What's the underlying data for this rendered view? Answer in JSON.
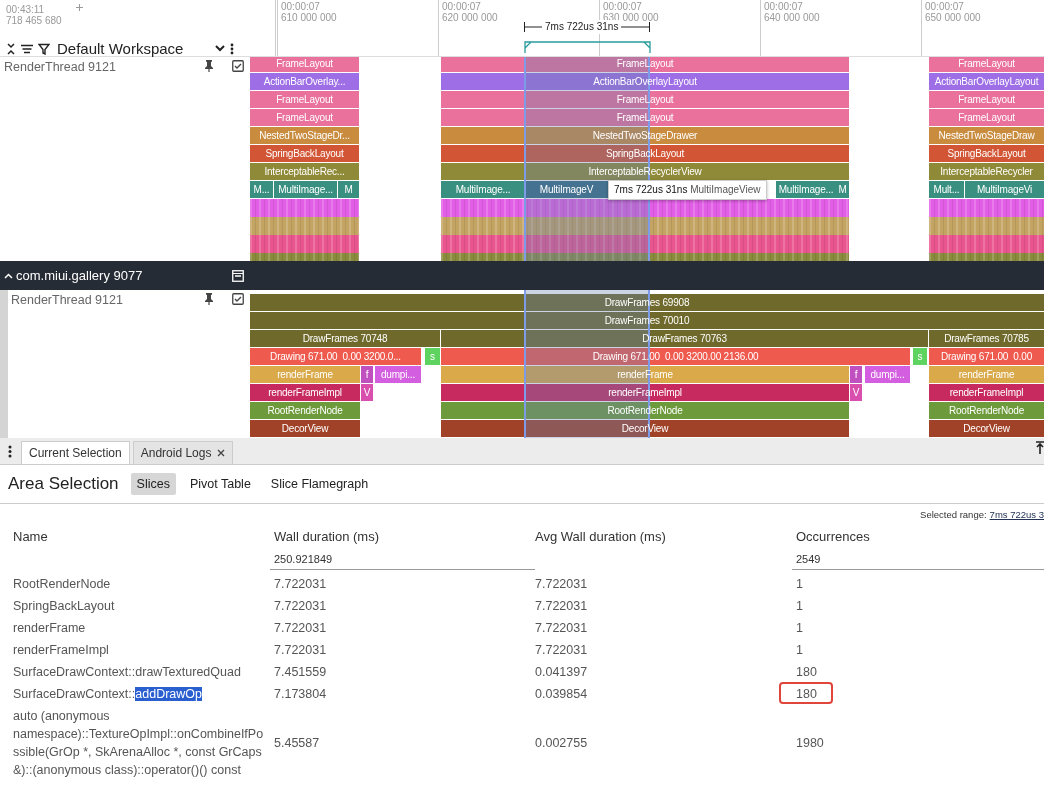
{
  "timeline": {
    "origin_time": "00:43:11",
    "origin_offset": "718 465 680",
    "workspace": "Default Workspace",
    "selection_span": "7ms 722us 31ns",
    "ticks": [
      {
        "time": "00:00:07",
        "offset": "610 000 000"
      },
      {
        "time": "00:00:07",
        "offset": "620 000 000"
      },
      {
        "time": "00:00:07",
        "offset": "630 000 000"
      },
      {
        "time": "00:00:07",
        "offset": "640 000 000"
      },
      {
        "time": "00:00:07",
        "offset": "650 000 000"
      }
    ]
  },
  "tracks": [
    {
      "name": "RenderThread 9121",
      "checked": true,
      "slice_rows": [
        [
          {
            "label": "FrameLayout",
            "color": "#e9719b"
          },
          {
            "label": "FrameLayout",
            "color": "#e9719b"
          },
          {
            "label": "FrameLayout",
            "color": "#e9719b"
          }
        ],
        [
          {
            "label": "ActionBarOverlay...",
            "color": "#9d6ee6"
          },
          {
            "label": "ActionBarOverlayLayout",
            "color": "#9d6ee6"
          },
          {
            "label": "ActionBarOverlayLayout",
            "color": "#9d6ee6"
          }
        ],
        [
          {
            "label": "FrameLayout",
            "color": "#e9719b"
          },
          {
            "label": "FrameLayout",
            "color": "#e9719b"
          },
          {
            "label": "FrameLayout",
            "color": "#e9719b"
          }
        ],
        [
          {
            "label": "FrameLayout",
            "color": "#e9719b"
          },
          {
            "label": "FrameLayout",
            "color": "#e9719b"
          },
          {
            "label": "FrameLayout",
            "color": "#e9719b"
          }
        ],
        [
          {
            "label": "NestedTwoStageDr...",
            "color": "#c98c3f"
          },
          {
            "label": "NestedTwoStageDrawer",
            "color": "#c98c3f"
          },
          {
            "label": "NestedTwoStageDraw",
            "color": "#c98c3f"
          }
        ],
        [
          {
            "label": "SpringBackLayout",
            "color": "#d25535"
          },
          {
            "label": "SpringBackLayout",
            "color": "#d25535"
          },
          {
            "label": "SpringBackLayout",
            "color": "#d25535"
          }
        ],
        [
          {
            "label": "InterceptableRec...",
            "color": "#8f8a37"
          },
          {
            "label": "InterceptableRecyclerView",
            "color": "#8f8a37"
          },
          {
            "label": "InterceptableRecycler",
            "color": "#8f8a37"
          }
        ],
        [
          {
            "label": "M...",
            "color": "#3a9080"
          },
          {
            "label": "MultiImage...",
            "color": "#3a9080"
          },
          {
            "label": "M",
            "color": "#3a9080"
          },
          {
            "label": "MultiImage...",
            "color": "#3a9080"
          },
          {
            "label": "MultiImageV",
            "color": "#2f6a80"
          },
          {
            "label": "MultiImage...",
            "color": "#3a9080"
          },
          {
            "label": "M",
            "color": "#3a9080"
          },
          {
            "label": "Mult...",
            "color": "#3a9080"
          },
          {
            "label": "MultiImageVi",
            "color": "#3a9080"
          }
        ]
      ],
      "tooltip": "**7ms 722us 31ns** MultiImageView"
    },
    {
      "name": "RenderThread 9121",
      "checked": true,
      "slice_rows": [
        [
          {
            "label": "DrawFrames 69908",
            "color": "#6f6a2c"
          }
        ],
        [
          {
            "label": "DrawFrames 70010",
            "color": "#6f6a2c"
          }
        ],
        [
          {
            "label": "DrawFrames 70748",
            "color": "#6f6a2c"
          },
          {
            "label": "DrawFrames 70763",
            "color": "#6f6a2c"
          },
          {
            "label": "DrawFrames 70785",
            "color": "#6f6a2c"
          }
        ],
        [
          {
            "label": "Drawing 671.00  0.00 3200.0...",
            "color": "#ef5a4e"
          },
          {
            "label": "s",
            "color": "#5fd35f"
          },
          {
            "label": "Drawing 671.00  0.00 3200.00 2136.00",
            "color": "#ef5a4e"
          },
          {
            "label": "s",
            "color": "#5fd35f"
          },
          {
            "label": "Drawing 671.00  0.00",
            "color": "#ef5a4e"
          }
        ],
        [
          {
            "label": "renderFrame",
            "color": "#d9a94a"
          },
          {
            "label": "f",
            "color": "#c04fc0"
          },
          {
            "label": "dumpi...",
            "color": "#d45ee0"
          },
          {
            "label": "renderFrame",
            "color": "#d9a94a"
          },
          {
            "label": "f",
            "color": "#c04fc0"
          },
          {
            "label": "dumpi...",
            "color": "#d45ee0"
          },
          {
            "label": "renderFrame",
            "color": "#d9a94a"
          }
        ],
        [
          {
            "label": "renderFrameImpl",
            "color": "#c72a5e"
          },
          {
            "label": "V",
            "color": "#d84fae"
          },
          {
            "label": "renderFrameImpl",
            "color": "#c72a5e"
          },
          {
            "label": "V",
            "color": "#d84fae"
          },
          {
            "label": "renderFrameImpl",
            "color": "#c72a5e"
          }
        ],
        [
          {
            "label": "RootRenderNode",
            "color": "#6d9a3a"
          },
          {
            "label": "RootRenderNode",
            "color": "#6d9a3a"
          },
          {
            "label": "RootRenderNode",
            "color": "#6d9a3a"
          }
        ],
        [
          {
            "label": "DecorView",
            "color": "#a04228"
          },
          {
            "label": "DecorView",
            "color": "#a04228"
          },
          {
            "label": "DecorView",
            "color": "#a04228"
          }
        ]
      ]
    }
  ],
  "group": {
    "title": "com.miui.gallery 9077",
    "expanded": true
  },
  "details": {
    "tabs": [
      {
        "label": "Current Selection",
        "selected": true,
        "closable": false
      },
      {
        "label": "Android Logs",
        "selected": false,
        "closable": true
      }
    ],
    "title": "Area Selection",
    "views": [
      {
        "label": "Slices",
        "selected": true
      },
      {
        "label": "Pivot Table",
        "selected": false
      },
      {
        "label": "Slice Flamegraph",
        "selected": false
      }
    ],
    "selected_range_label": "Selected range:",
    "selected_range_value": "7ms 722us 3",
    "columns": [
      "Name",
      "Wall duration (ms)",
      "Avg Wall duration (ms)",
      "Occurrences"
    ],
    "totals": {
      "wall_duration": "250.921849",
      "occurrences": "2549"
    },
    "rows": [
      {
        "name": "RootRenderNode",
        "wall": "7.722031",
        "avg": "7.722031",
        "occurrences": "1",
        "annotated": false
      },
      {
        "name": "SpringBackLayout",
        "wall": "7.722031",
        "avg": "7.722031",
        "occurrences": "1",
        "annotated": false
      },
      {
        "name": "renderFrame",
        "wall": "7.722031",
        "avg": "7.722031",
        "occurrences": "1",
        "annotated": false
      },
      {
        "name": "renderFrameImpl",
        "wall": "7.722031",
        "avg": "7.722031",
        "occurrences": "1",
        "annotated": false
      },
      {
        "name": "SurfaceDrawContext::drawTexturedQuad",
        "wall": "7.451559",
        "avg": "0.041397",
        "occurrences": "180",
        "annotated": false
      },
      {
        "name_parts": [
          {
            "text": "SurfaceDrawContext::",
            "highlighted": false
          },
          {
            "text": "addDrawOp",
            "highlighted": true
          }
        ],
        "wall": "7.173804",
        "avg": "0.039854",
        "occurrences": "180",
        "annotated": true
      },
      {
        "name": "auto (anonymous namespace)::TextureOpImpl::onCombineIfPossible(GrOp *, SkArenaAlloc *, const GrCaps &)::(anonymous class)::operator()() const",
        "wall": "5.45587",
        "avg": "0.002755",
        "occurrences": "1980",
        "annotated": false
      }
    ]
  }
}
